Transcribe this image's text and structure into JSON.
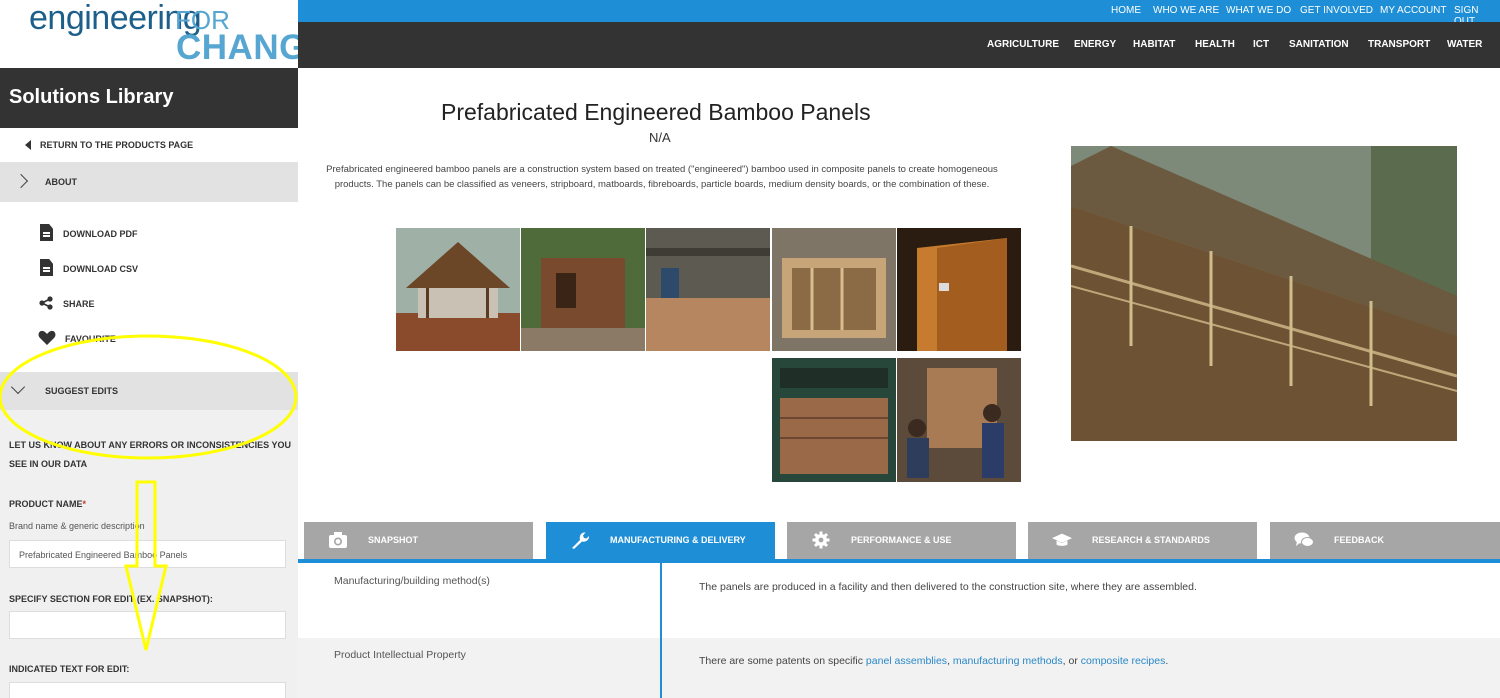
{
  "logo": {
    "line1": "engineering",
    "line2a": "FOR",
    "line2b": "CHANGE"
  },
  "sidebar": {
    "title": "Solutions Library",
    "return_label": "RETURN TO THE PRODUCTS PAGE",
    "about_label": "ABOUT",
    "actions": {
      "download_pdf": "DOWNLOAD PDF",
      "download_csv": "DOWNLOAD CSV",
      "share": "SHARE",
      "favourite": "FAVOURITE"
    },
    "suggest_label": "SUGGEST EDITS",
    "form": {
      "note": "LET US KNOW ABOUT ANY ERRORS OR INCONSISTENCIES YOU SEE IN OUR DATA",
      "product_name_label": "PRODUCT NAME",
      "required_mark": "*",
      "product_name_hint": "Brand name & generic description",
      "product_name_value": "Prefabricated Engineered Bamboo Panels",
      "section_label": "SPECIFY SECTION FOR EDIT (EX. SNAPSHOT):",
      "section_value": "",
      "text_label": "INDICATED TEXT FOR EDIT:",
      "text_value": ""
    }
  },
  "top_nav": [
    "HOME",
    "WHO WE ARE",
    "WHAT WE DO",
    "GET INVOLVED",
    "MY ACCOUNT",
    "SIGN OUT"
  ],
  "category_nav": [
    "AGRICULTURE",
    "ENERGY",
    "HABITAT",
    "HEALTH",
    "ICT",
    "SANITATION",
    "TRANSPORT",
    "WATER"
  ],
  "product": {
    "title": "Prefabricated Engineered Bamboo Panels",
    "subtitle": "N/A",
    "description": "Prefabricated engineered bamboo panels are a construction system based on treated (\"engineered\") bamboo used in composite panels to create homogeneous products. The panels can be classified as veneers, stripboard, matboards, fibreboards, particle boards, medium density boards, or the combination of these."
  },
  "tabs": [
    {
      "label": "SNAPSHOT",
      "icon": "camera-icon",
      "active": false
    },
    {
      "label": "MANUFACTURING & DELIVERY",
      "icon": "wrench-icon",
      "active": true
    },
    {
      "label": "PERFORMANCE & USE",
      "icon": "gear-icon",
      "active": false
    },
    {
      "label": "RESEARCH & STANDARDS",
      "icon": "graduation-cap-icon",
      "active": false
    },
    {
      "label": "FEEDBACK",
      "icon": "chat-bubbles-icon",
      "active": false
    }
  ],
  "details": {
    "row1": {
      "key": "Manufacturing/building method(s)",
      "value": "The panels are produced in a facility and then delivered to the construction site, where they are assembled."
    },
    "row2": {
      "key": "Product Intellectual Property",
      "prefix": "There are some patents on specific ",
      "link1": "panel assemblies",
      "sep1": ", ",
      "link2": "manufacturing methods",
      "sep2": ", or ",
      "link3": "composite recipes",
      "suffix": "."
    }
  },
  "colors": {
    "brand_blue": "#1e8fd6",
    "dark_bar": "#333333",
    "tab_inactive": "#a6a6a6",
    "link": "#2a88c9",
    "annotation": "#ffff00"
  }
}
